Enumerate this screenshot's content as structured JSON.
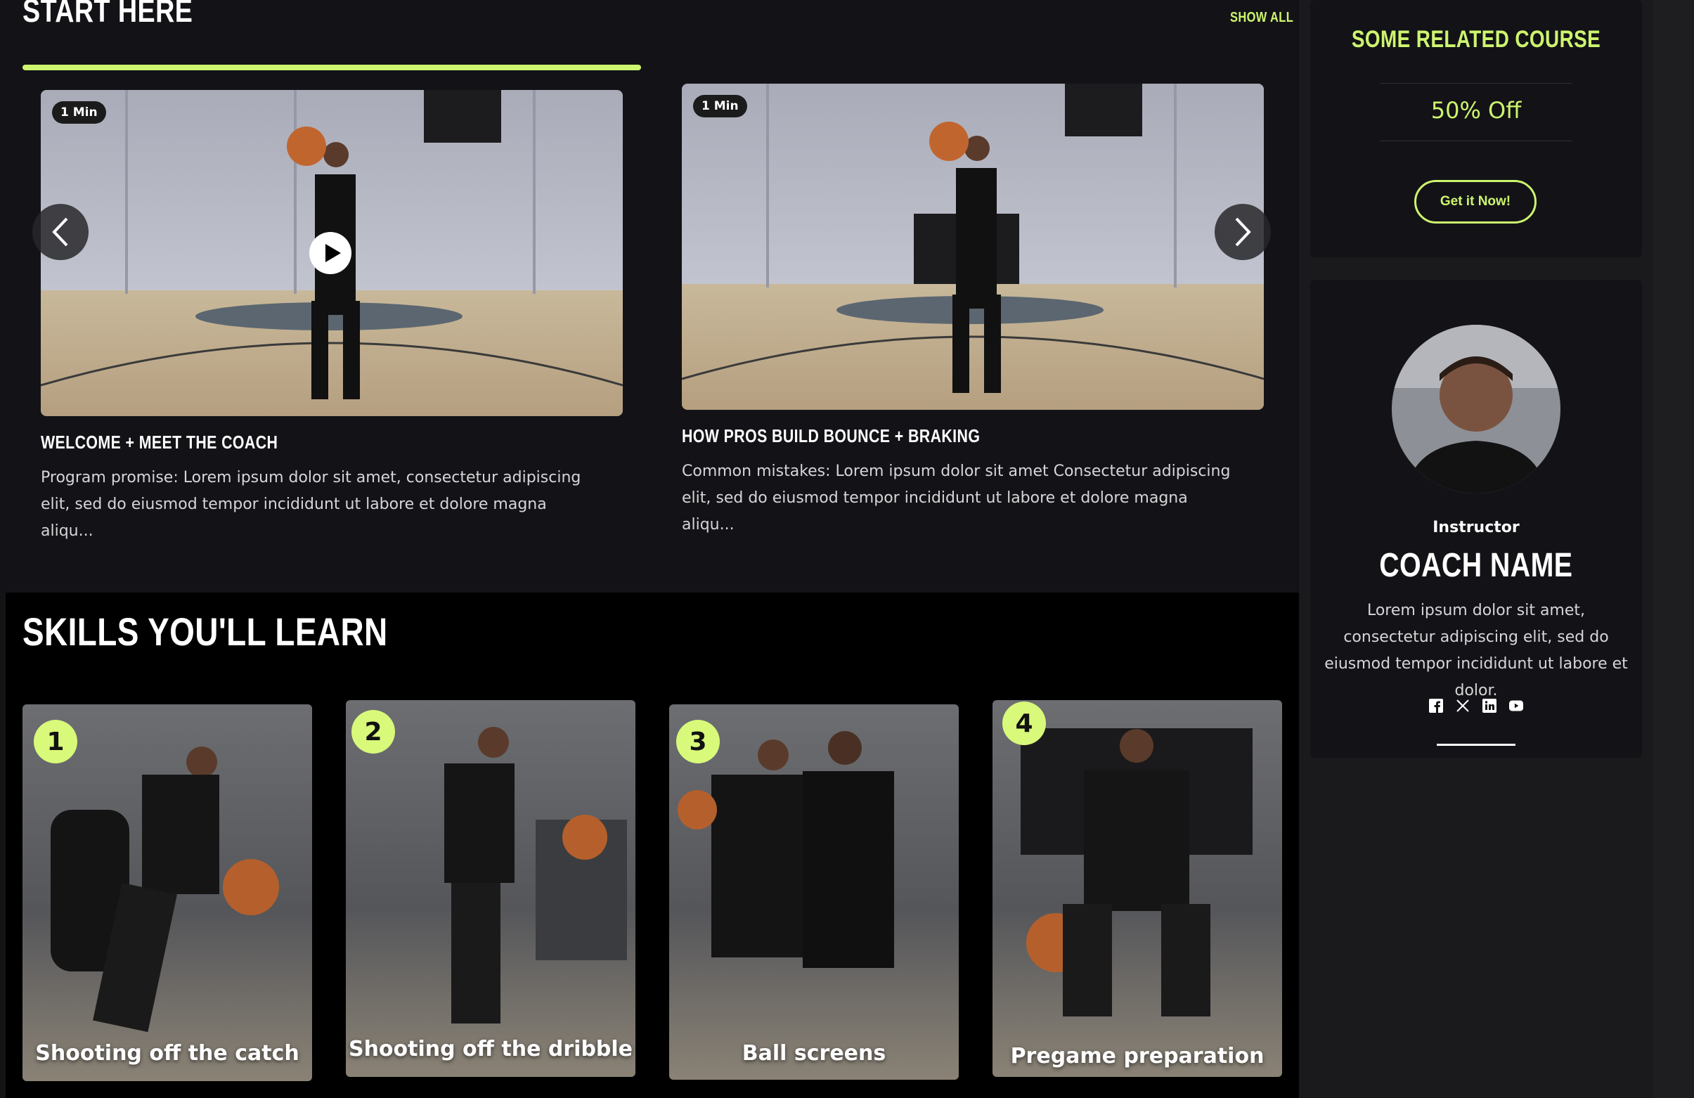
{
  "start_section": {
    "title": "START HERE",
    "show_all": "SHOW ALL",
    "videos": [
      {
        "duration": "1 Min",
        "title": "WELCOME + MEET THE COACH",
        "description": "Program promise: Lorem ipsum dolor sit amet, consectetur adipiscing elit, sed do eiusmod tempor incididunt ut labore et dolore magna aliqu..."
      },
      {
        "duration": "1 Min",
        "title": "HOW PROS BUILD BOUNCE + BRAKING",
        "description": "Common mistakes: Lorem ipsum dolor sit amet Consectetur adipiscing elit, sed do eiusmod tempor incididunt ut labore et dolore magna aliqu..."
      }
    ]
  },
  "skills_section": {
    "title": "SKILLS YOU'LL LEARN",
    "skills": [
      {
        "number": "1",
        "label": "Shooting off the catch"
      },
      {
        "number": "2",
        "label": "Shooting off the dribble"
      },
      {
        "number": "3",
        "label": "Ball screens"
      },
      {
        "number": "4",
        "label": "Pregame preparation"
      }
    ]
  },
  "promo": {
    "title": "SOME RELATED COURSE",
    "discount": "50% Off",
    "cta": "Get it Now!"
  },
  "coach": {
    "role": "Instructor",
    "name": "COACH NAME",
    "bio": "Lorem ipsum dolor sit amet, consectetur adipiscing elit, sed do eiusmod tempor incididunt ut labore et dolor.",
    "socials": [
      "facebook-icon",
      "x-icon",
      "linkedin-icon",
      "youtube-icon"
    ]
  },
  "colors": {
    "accent": "#cdf56e",
    "background": "#131317"
  }
}
